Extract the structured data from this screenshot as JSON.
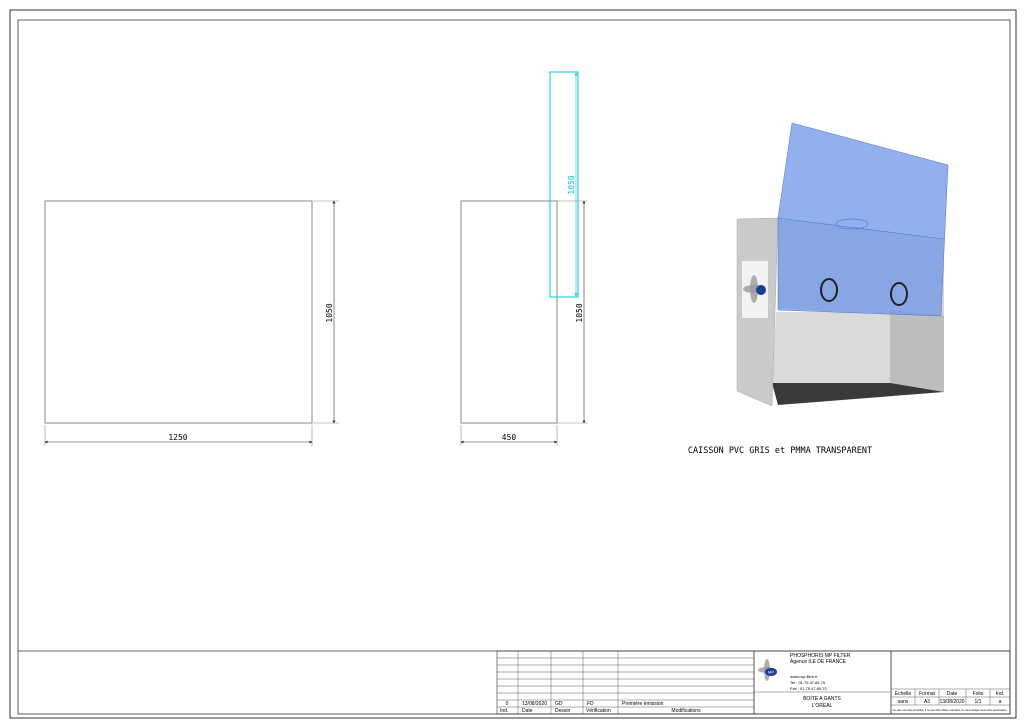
{
  "dims": {
    "front_width": "1250",
    "front_height": "1050",
    "side_depth": "450",
    "side_height": "1050",
    "lid_height": "1050"
  },
  "caption": "CAISSON PVC GRIS et PMMA TRANSPARENT",
  "revision": {
    "ind": "0",
    "date": "13/08/2020",
    "dessin": "GD",
    "verification": "FD",
    "modification": "Première émission",
    "headers": {
      "ind": "Ind.",
      "date": "Date",
      "dessin": "Dessin",
      "verification": "Vérification",
      "modifications": "Modifications"
    }
  },
  "company": {
    "name": "PHOSPHORIS MP FILTER",
    "agency": "Agence ILE DE FRANCE",
    "website": "www.mp-filtre.fr",
    "tel": "Tel : 01.75.47.85.75",
    "fax": "Fax : 01.75.47.85.70",
    "logo_text": "MP"
  },
  "project": {
    "title": "BOITE A GANTS",
    "client": "L'OREAL"
  },
  "info": {
    "headers": {
      "scale": "Echelle",
      "format": "Format",
      "date": "Date",
      "folio": "Folio",
      "ind": "Ind."
    },
    "scale": "sans",
    "format": "A3",
    "date": "13/08/2020",
    "folio": "1/1",
    "ind": "a",
    "notice": "Ce plan est notre propriété. Il ne peut être utilisé, reproduit, ou communiqué sans notre autorisation."
  },
  "colors": {
    "dimension_cyan": "#00c8d8",
    "pmma_blue": "#6f95e8",
    "pvc_grey": "#c9c9c9"
  }
}
